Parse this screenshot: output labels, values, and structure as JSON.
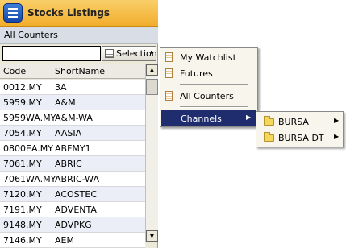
{
  "window": {
    "title": "Stocks Listings"
  },
  "subheader": {
    "label": "All Counters"
  },
  "search": {
    "value": "",
    "placeholder": ""
  },
  "selection_button": {
    "label": "Selection",
    "arrow": "▸"
  },
  "table": {
    "columns": [
      "Code",
      "ShortName"
    ],
    "rows": [
      {
        "code": "0012.MY",
        "short": "3A"
      },
      {
        "code": "5959.MY",
        "short": "A&M"
      },
      {
        "code": "5959WA.MY",
        "short": "A&M-WA"
      },
      {
        "code": "7054.MY",
        "short": "AASIA"
      },
      {
        "code": "0800EA.MY",
        "short": "ABFMY1"
      },
      {
        "code": "7061.MY",
        "short": "ABRIC"
      },
      {
        "code": "7061WA.MY",
        "short": "ABRIC-WA"
      },
      {
        "code": "7120.MY",
        "short": "ACOSTEC"
      },
      {
        "code": "7191.MY",
        "short": "ADVENTA"
      },
      {
        "code": "9148.MY",
        "short": "ADVPKG"
      },
      {
        "code": "7146.MY",
        "short": "AEM"
      }
    ]
  },
  "selection_menu": {
    "items": [
      {
        "label": "My Watchlist"
      },
      {
        "label": "Futures"
      },
      {
        "label": "All Counters"
      },
      {
        "label": "Channels",
        "arrow": "▶"
      }
    ]
  },
  "channels_menu": {
    "items": [
      {
        "label": "BURSA",
        "arrow": "▶"
      },
      {
        "label": "BURSA DT",
        "arrow": "▶"
      }
    ]
  },
  "colors": {
    "title_bar": "#f2ad2b",
    "menu_highlight": "#1f2d6e",
    "alt_row": "#eceef7"
  }
}
